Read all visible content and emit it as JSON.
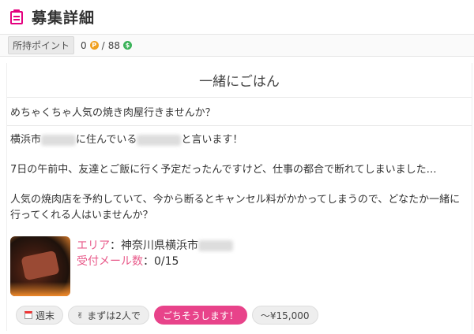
{
  "header": {
    "title": "募集詳細",
    "icon": "clipboard-icon"
  },
  "points": {
    "label": "所持ポイント",
    "p_value": "0",
    "p_icon": "P",
    "separator": "/",
    "s_value": "88",
    "s_icon": "$"
  },
  "card": {
    "title": "一緒にごはん",
    "subtitle": "めちゃくちゃ人気の焼き肉屋行きませんか？",
    "body": {
      "line1_prefix": "横浜市",
      "line1_mid": "に住んでいる",
      "line1_suffix": "と言います！",
      "para2": "7日の午前中、友達とご飯に行く予定だったんですけど、仕事の都合で断れてしまいました…",
      "para3": "人気の焼肉店を予約していて、今から断るとキャンセル料がかかってしまうので、どなたか一緒に行ってくれる人はいませんか？"
    },
    "info": {
      "area_key": "エリア",
      "area_value": "：神奈川県横浜市",
      "mail_key": "受付メール数",
      "mail_value": "：0/15"
    },
    "tags": [
      {
        "label": "週末",
        "icon": "calendar-icon"
      },
      {
        "label": "まずは2人で",
        "icon": "peace-hand-icon"
      },
      {
        "label": "ごちそうします！",
        "style": "pink"
      },
      {
        "label": "～¥15,000"
      }
    ]
  },
  "colors": {
    "accent": "#e4007f",
    "key_text": "#e85a8a",
    "pill_pink": "#e8438a"
  }
}
